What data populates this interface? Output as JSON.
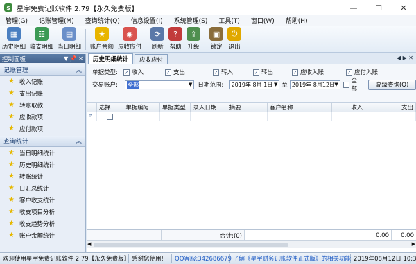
{
  "window": {
    "title": "星宇免费记账软件 2.79【永久免费版】",
    "min": "—",
    "max": "☐",
    "close": "✕"
  },
  "menu": [
    "管理(G)",
    "记账管理(M)",
    "查询统计(Q)",
    "信息设置(I)",
    "系统管理(S)",
    "工具(T)",
    "窗口(W)",
    "帮助(H)"
  ],
  "toolbar": [
    {
      "label": "历史明细",
      "icon": "history-icon",
      "color": "#4a7fc1",
      "glyph": "▦"
    },
    {
      "label": "收支明细",
      "icon": "ledger-icon",
      "color": "#3b9a55",
      "glyph": "☷"
    },
    {
      "label": "当日明细",
      "icon": "calendar-icon",
      "color": "#6a8fc9",
      "glyph": "▤"
    },
    {
      "label": "账户余额",
      "icon": "star-icon",
      "color": "#e8b500",
      "glyph": "★"
    },
    {
      "label": "应收应付",
      "icon": "receivable-icon",
      "color": "#d9534f",
      "glyph": "◉"
    },
    {
      "label": "刷新",
      "icon": "refresh-icon",
      "color": "#5a78a8",
      "glyph": "⟳"
    },
    {
      "label": "帮助",
      "icon": "help-icon",
      "color": "#c23b3b",
      "glyph": "?"
    },
    {
      "label": "升级",
      "icon": "upgrade-icon",
      "color": "#4f8f4f",
      "glyph": "⇪"
    },
    {
      "label": "锁定",
      "icon": "lock-icon",
      "color": "#8a6d3b",
      "glyph": "▣"
    },
    {
      "label": "退出",
      "icon": "exit-icon",
      "color": "#e0a800",
      "glyph": "⏻"
    }
  ],
  "panel": {
    "title": "控制面板",
    "pin": "▼ 📌 ✕",
    "groups": [
      {
        "title": "记账管理",
        "items": [
          "收入记账",
          "支出记账",
          "转账取款",
          "应收款项",
          "应付款项"
        ]
      },
      {
        "title": "查询统计",
        "items": [
          "当日明细统计",
          "历史明细统计",
          "转账统计",
          "日汇总统计",
          "客户收支统计",
          "收支项目分析",
          "收支趋势分析",
          "账户余额统计"
        ]
      }
    ],
    "collapse": "︽"
  },
  "tabs": [
    {
      "label": "历史明细统计",
      "active": true
    },
    {
      "label": "应收应付",
      "active": false
    }
  ],
  "tab_controls": "◀ ▶ ✕",
  "filter": {
    "type_label": "单据类型:",
    "types": [
      {
        "label": "收入",
        "checked": true
      },
      {
        "label": "支出",
        "checked": true
      },
      {
        "label": "转入",
        "checked": true
      },
      {
        "label": "转出",
        "checked": true
      },
      {
        "label": "应收入账",
        "checked": true
      },
      {
        "label": "应付入账",
        "checked": true
      }
    ],
    "account_label": "交易账户:",
    "account_value": "全部",
    "date_label": "日期范围:",
    "date_from": "2019年 8月 1日",
    "date_sep": "至",
    "date_to": "2019年 8月12日",
    "all_label": "全部",
    "all_checked": false,
    "query_button": "高级查询(Q)"
  },
  "grid": {
    "columns": [
      "选择",
      "单据编号",
      "单据类型",
      "录入日期",
      "摘要",
      "客户名称",
      "收入",
      "支出"
    ],
    "footer": {
      "label": "合计:(0)",
      "income": "0.00",
      "expense": "0.00"
    }
  },
  "status": {
    "welcome": "欢迎使用星宇免费记账软件 2.79【永久免费版】",
    "thanks": "感谢您使用!",
    "qq": "QQ客服:342686679",
    "link": "了解《星宇财务记账软件正式版》的相关功能",
    "clock": "2019年08月12日 10:33:45"
  }
}
